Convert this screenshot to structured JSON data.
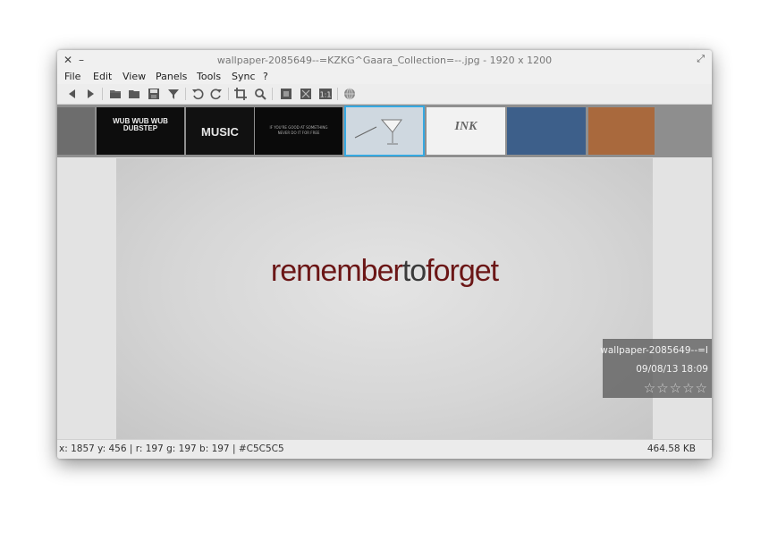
{
  "window": {
    "title": "wallpaper-2085649--=KZKG^Gaara_Collection=--.jpg  - 1920 x 1200",
    "close_glyph": "✕",
    "minimize_glyph": "–",
    "maximize_glyph": "⤢"
  },
  "menu": [
    "File",
    "Edit",
    "View",
    "Panels",
    "Tools",
    "Sync",
    "?"
  ],
  "toolbar": {
    "icons": [
      "back-icon",
      "forward-icon",
      "folder-open-icon",
      "folder-icon",
      "save-icon",
      "filter-icon",
      "rotate-left-icon",
      "rotate-right-icon",
      "crop-icon",
      "zoom-icon",
      "fit-window-icon",
      "fullscreen-icon",
      "actual-size-icon",
      "web-icon"
    ],
    "actual_size_label": "1:1"
  },
  "filmstrip": [
    {
      "text": "",
      "bg": "#6d6d6d"
    },
    {
      "text": "WUB WUB WUB DUBSTEP",
      "bg": "#0d0d0d"
    },
    {
      "text": "MUSIC",
      "bg": "#111111"
    },
    {
      "text": "IF YOU'RE GOOD AT SOMETHING NEVER DO IT FOR FREE",
      "bg": "#0a0a0a"
    },
    {
      "text": "",
      "bg": "#cfd8e0",
      "selected": true
    },
    {
      "text": "INK",
      "bg": "#f2f2f2"
    },
    {
      "text": "",
      "bg": "#3d5f8a"
    },
    {
      "text": "",
      "bg": "#a9693d"
    },
    {
      "text": "",
      "bg": "#8e8e8e"
    }
  ],
  "image": {
    "words": [
      {
        "text": "remember",
        "color": "#6b1616"
      },
      {
        "text": "to",
        "color": "#3a3a3a"
      },
      {
        "text": "forget",
        "color": "#6b1616"
      }
    ]
  },
  "info": {
    "filename": "wallpaper-2085649--=I",
    "datetime": "09/08/13 18:09",
    "rating": "☆☆☆☆☆"
  },
  "status": {
    "pixel": "x: 1857 y: 456 | r: 197 g: 197 b: 197 | #C5C5C5",
    "filesize": "464.58 KB"
  }
}
